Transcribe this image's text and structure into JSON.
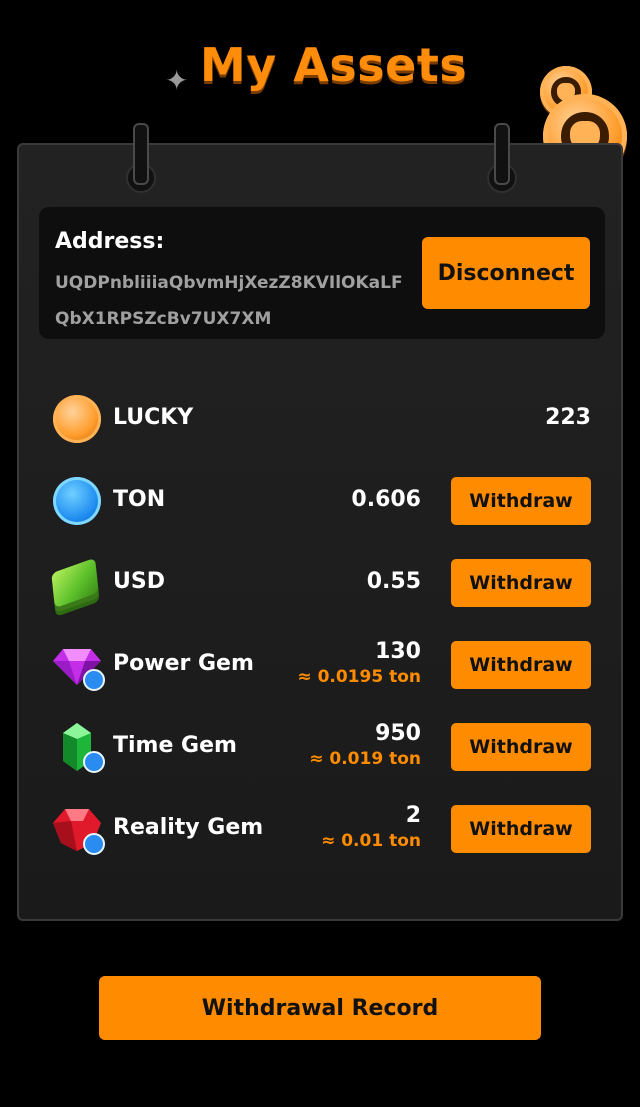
{
  "header": {
    "title": "My Assets",
    "sparkle_icon": "sparkle-icon",
    "coin_small_icon": "lucky-coin-icon",
    "coin_big_icon": "lucky-coin-icon"
  },
  "address_card": {
    "label": "Address:",
    "value": "UQDPnbliiiaQbvmHjXezZ8KVIlOKaLFQbX1RPSZcBv7UX7XM",
    "disconnect_label": "Disconnect"
  },
  "assets": [
    {
      "name": "LUCKY",
      "amount": "223",
      "icon": "lucky-coin-icon"
    },
    {
      "name": "TON",
      "amount": "0.606",
      "icon": "ton-icon",
      "action": "Withdraw"
    },
    {
      "name": "USD",
      "amount": "0.55",
      "icon": "cash-stack-icon",
      "action": "Withdraw"
    },
    {
      "name": "Power Gem",
      "amount": "130",
      "approx": "≈ 0.0195 ton",
      "icon": "purple-gem-icon",
      "action": "Withdraw"
    },
    {
      "name": "Time Gem",
      "amount": "950",
      "approx": "≈ 0.019 ton",
      "icon": "green-gem-icon",
      "action": "Withdraw"
    },
    {
      "name": "Reality Gem",
      "amount": "2",
      "approx": "≈ 0.01 ton",
      "icon": "red-gem-icon",
      "action": "Withdraw"
    }
  ],
  "footer": {
    "record_label": "Withdrawal Record"
  },
  "colors": {
    "accent": "#ff8c00",
    "background": "#000000",
    "panel": "#1e1e1e",
    "approx_text": "#ff8c00"
  }
}
